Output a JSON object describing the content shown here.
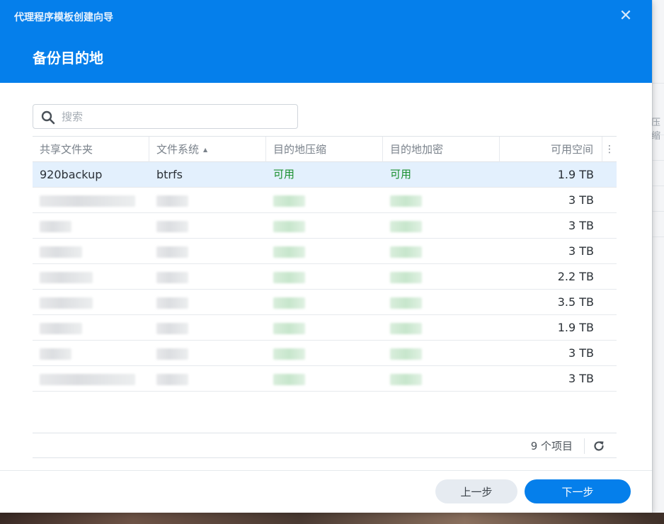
{
  "dialog": {
    "wizard_title": "代理程序模板创建向导",
    "close_glyph": "✕",
    "step_title": "备份目的地"
  },
  "search": {
    "placeholder": "搜索"
  },
  "table": {
    "columns": [
      {
        "label": "共享文件夹"
      },
      {
        "label": "文件系统",
        "sort": "ascending"
      },
      {
        "label": "目的地压缩"
      },
      {
        "label": "目的地加密"
      },
      {
        "label": "可用空间"
      }
    ],
    "rows": [
      {
        "folder": "920backup",
        "fs": "btrfs",
        "compression": "可用",
        "encryption": "可用",
        "space": "1.9 TB",
        "selected": true,
        "redacted": false
      },
      {
        "space": "3 TB",
        "redacted": true
      },
      {
        "space": "3 TB",
        "redacted": true
      },
      {
        "space": "3 TB",
        "redacted": true
      },
      {
        "space": "2.2 TB",
        "redacted": true
      },
      {
        "space": "3.5 TB",
        "redacted": true
      },
      {
        "space": "1.9 TB",
        "redacted": true
      },
      {
        "space": "3 TB",
        "redacted": true
      },
      {
        "space": "3 TB",
        "redacted": true
      }
    ]
  },
  "footer": {
    "item_count": "9 个项目"
  },
  "buttons": {
    "prev": "上一步",
    "next": "下一步"
  },
  "background": {
    "partial_text": "压缩"
  },
  "colors": {
    "header": "#057feb",
    "accent": "#057feb",
    "available_text": "#1a8f2e",
    "selected_row": "#e3f0fd"
  },
  "icons": {
    "close": "close-icon",
    "search": "search-icon",
    "refresh": "refresh-icon",
    "more": "more-vertical-icon",
    "sort": "sort-ascending-icon"
  }
}
